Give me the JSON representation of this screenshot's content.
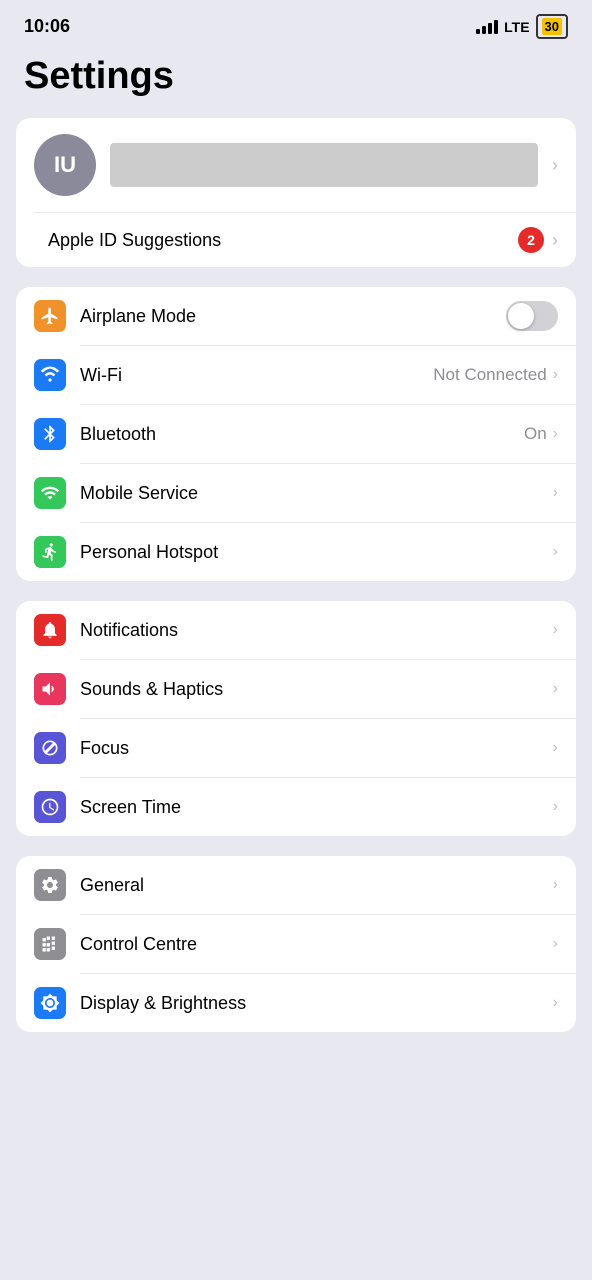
{
  "statusBar": {
    "time": "10:06",
    "lte": "LTE",
    "battery": "30"
  },
  "pageTitle": "Settings",
  "profile": {
    "initials": "IU",
    "chevron": "›"
  },
  "appleId": {
    "label": "Apple ID Suggestions",
    "badge": "2",
    "chevron": "›"
  },
  "connectivity": [
    {
      "id": "airplane",
      "label": "Airplane Mode",
      "iconColor": "icon-orange",
      "hasToggle": true,
      "toggleOn": false
    },
    {
      "id": "wifi",
      "label": "Wi-Fi",
      "value": "Not Connected",
      "iconColor": "icon-blue",
      "hasChevron": true
    },
    {
      "id": "bluetooth",
      "label": "Bluetooth",
      "value": "On",
      "iconColor": "icon-blue-bt",
      "hasChevron": true
    },
    {
      "id": "mobile",
      "label": "Mobile Service",
      "iconColor": "icon-green",
      "hasChevron": true
    },
    {
      "id": "hotspot",
      "label": "Personal Hotspot",
      "iconColor": "icon-green2",
      "hasChevron": true
    }
  ],
  "notifications": [
    {
      "id": "notifications",
      "label": "Notifications",
      "iconColor": "icon-red",
      "hasChevron": true
    },
    {
      "id": "sounds",
      "label": "Sounds & Haptics",
      "iconColor": "icon-pink",
      "hasChevron": true
    },
    {
      "id": "focus",
      "label": "Focus",
      "iconColor": "icon-indigo",
      "hasChevron": true
    },
    {
      "id": "screentime",
      "label": "Screen Time",
      "iconColor": "icon-indigo",
      "hasChevron": true
    }
  ],
  "general": [
    {
      "id": "general",
      "label": "General",
      "iconColor": "icon-blue-gray",
      "hasChevron": true
    },
    {
      "id": "controlcentre",
      "label": "Control Centre",
      "iconColor": "icon-blue-gray",
      "hasChevron": true
    },
    {
      "id": "display",
      "label": "Display & Brightness",
      "iconColor": "icon-blue",
      "hasChevron": true
    }
  ]
}
